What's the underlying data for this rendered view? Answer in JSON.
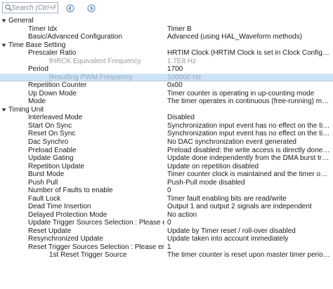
{
  "toolbar": {
    "search_placeholder": "Search (Ctrl+F)"
  },
  "rows": [
    {
      "type": "group",
      "name": "General"
    },
    {
      "type": "prop",
      "level": 1,
      "name": "Timer Idx",
      "value": "Timer B"
    },
    {
      "type": "prop",
      "level": 1,
      "name": "Basic/Advanced Configuration",
      "value": "Advanced (using HAL_Waveform methods)"
    },
    {
      "type": "group",
      "name": "Time Base Setting"
    },
    {
      "type": "prop",
      "level": 1,
      "name": "Prescaler Ratio",
      "value": "HRTIM Clock (HRTIM Clock is set in Clock Configuration Tab)"
    },
    {
      "type": "prop",
      "level": 2,
      "dim": true,
      "name": "fHRCK Equivalent Frequency",
      "value": "1.7E8 Hz"
    },
    {
      "type": "prop",
      "level": 1,
      "name": "Period",
      "value": "1700"
    },
    {
      "type": "prop",
      "level": 2,
      "selected": true,
      "name": "Resulting PWM Frequency",
      "value": "100000 Hz"
    },
    {
      "type": "prop",
      "level": 1,
      "name": "Repetition Counter",
      "value": "0x00"
    },
    {
      "type": "prop",
      "level": 1,
      "name": "Up Down Mode",
      "value": "Timer counter is operating in up-counting mode"
    },
    {
      "type": "prop",
      "level": 1,
      "name": "Mode",
      "value": "The timer operates in continuous (free-running) mode"
    },
    {
      "type": "group",
      "name": "Timing Unit"
    },
    {
      "type": "prop",
      "level": 1,
      "name": "Interleaved Mode",
      "value": "Disabled"
    },
    {
      "type": "prop",
      "level": 1,
      "name": "Start On Sync",
      "value": "Synchronization input event has no effect on the timer"
    },
    {
      "type": "prop",
      "level": 1,
      "name": "Reset On Sync",
      "value": "Synchronization input event has no effect on the timer"
    },
    {
      "type": "prop",
      "level": 1,
      "name": "Dac Synchro",
      "value": "No DAC synchronization event generated"
    },
    {
      "type": "prop",
      "level": 1,
      "name": "Preload Enable",
      "value": "Preload disabled: the write access is directly done into the active register"
    },
    {
      "type": "prop",
      "level": 1,
      "name": "Update Gating",
      "value": "Update done independently from the DMA burst transfer completion"
    },
    {
      "type": "prop",
      "level": 1,
      "name": "Repetition Update",
      "value": "Update on repetition disabled"
    },
    {
      "type": "prop",
      "level": 1,
      "name": "Burst Mode",
      "value": "Timer counter clock is maintained and the timer operates normally"
    },
    {
      "type": "prop",
      "level": 1,
      "name": "Push Pull",
      "value": "Push-Pull mode disabled"
    },
    {
      "type": "prop",
      "level": 1,
      "name": "Number of Faults to enable",
      "value": "0"
    },
    {
      "type": "prop",
      "level": 1,
      "name": "Fault Lock",
      "value": "Timer fault enabling bits are read/write"
    },
    {
      "type": "prop",
      "level": 1,
      "name": "Dead Time Insertion",
      "value": "Output 1 and output 2 signals are independent"
    },
    {
      "type": "prop",
      "level": 1,
      "name": "Delayed Protection Mode",
      "value": "No action"
    },
    {
      "type": "prop",
      "level": 1,
      "name": "Update Trigger Sources Selection : Please enter number",
      "value": "0"
    },
    {
      "type": "prop",
      "level": 1,
      "name": "Reset Update",
      "value": "Update by Timer reset / roll-over disabled"
    },
    {
      "type": "prop",
      "level": 1,
      "name": "Resynchronized Update",
      "value": "Update taken into account immediately"
    },
    {
      "type": "prop",
      "level": 1,
      "name": "Reset Trigger Sources Selection : Please enter number",
      "value": "1"
    },
    {
      "type": "prop",
      "level": 2,
      "name": "1st Reset Trigger Source",
      "value": "The timer counter is reset upon master timer period event"
    }
  ]
}
